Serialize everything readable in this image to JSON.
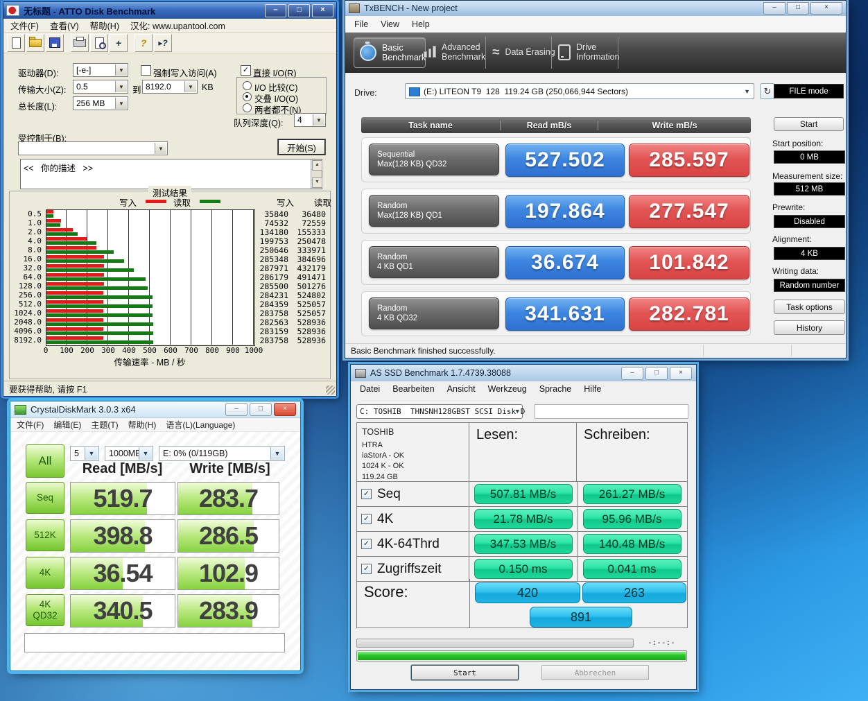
{
  "glyphs": {
    "minimize": "–",
    "maximize": "□",
    "close": "×",
    "dropdown": "▼",
    "up": "▲",
    "down": "▼",
    "check": "✓",
    "help": "?",
    "context_help": "?",
    "pan": "+",
    "refresh": "↻",
    "erase": "≈"
  },
  "atto": {
    "title": "无标题 - ATTO Disk Benchmark",
    "menu": {
      "file": "文件(F)",
      "view": "查看(V)",
      "help": "帮助(H)",
      "extra": "汉化: www.upantool.com"
    },
    "controls": {
      "drive_label": "驱动器(D):",
      "drive_value": "[-e-]",
      "force_write": "强制写入访问(A)",
      "direct_io": "直接 I/O(R)",
      "transfer_label": "传输大小(Z):",
      "transfer_from": "0.5",
      "to": "到",
      "transfer_to": "8192.0",
      "unit": "KB",
      "io_compare": "I/O 比较(C)",
      "overlapped": "交叠 I/O(O)",
      "neither": "两者都不(N)",
      "length_label": "总长度(L):",
      "length_value": "256 MB",
      "queue_label": "队列深度(Q):",
      "queue_value": "4",
      "controlled_by": "受控制于(B):",
      "start": "开始(S)",
      "description": "<<   你的描述   >>"
    },
    "results": {
      "group_title": "测试结果",
      "legend_write": "写入",
      "legend_read": "读取",
      "col_write": "写入",
      "col_read": "读取",
      "x_label": "传输速率 - MB / 秒"
    },
    "status": "要获得帮助, 请按 F1",
    "chart_data": {
      "type": "bar",
      "unit": "KB/s",
      "categories": [
        "0.5",
        "1.0",
        "2.0",
        "4.0",
        "8.0",
        "16.0",
        "32.0",
        "64.0",
        "128.0",
        "256.0",
        "512.0",
        "1024.0",
        "2048.0",
        "4096.0",
        "8192.0"
      ],
      "series": [
        {
          "name": "写入",
          "color": "#e31b1b",
          "values": [
            35840,
            74532,
            134180,
            199753,
            250646,
            285348,
            287971,
            286179,
            285500,
            284231,
            284359,
            283758,
            282563,
            283159,
            283758
          ]
        },
        {
          "name": "读取",
          "color": "#157a15",
          "values": [
            36480,
            72559,
            155333,
            250478,
            333971,
            384696,
            432179,
            491471,
            501276,
            524802,
            525057,
            525057,
            528936,
            528936,
            528936
          ]
        }
      ],
      "x_ticks": [
        0,
        100,
        200,
        300,
        400,
        500,
        600,
        700,
        800,
        900,
        1000
      ],
      "xlim": [
        0,
        1000
      ],
      "xlabel": "传输速率 - MB / 秒"
    }
  },
  "txbench": {
    "title": "TxBENCH - New project",
    "menu": [
      "File",
      "View",
      "Help"
    ],
    "tabs": [
      {
        "line1": "Basic",
        "line2": "Benchmark"
      },
      {
        "line1": "Advanced",
        "line2": "Benchmark"
      },
      {
        "line1": "Data Erasing",
        "line2": ""
      },
      {
        "line1": "Drive",
        "line2": "Information"
      }
    ],
    "drive_label": "Drive:",
    "drive_value": "(E:) LITEON T9  128  119.24 GB (250,066,944 Sectors)",
    "file_mode": "FILE mode",
    "table": {
      "headers": [
        "Task name",
        "Read mB/s",
        "Write mB/s"
      ],
      "rows": [
        {
          "name1": "Sequential",
          "name2": "Max(128 KB) QD32",
          "read": "527.502",
          "write": "285.597"
        },
        {
          "name1": "Random",
          "name2": "Max(128 KB) QD1",
          "read": "197.864",
          "write": "277.547"
        },
        {
          "name1": "Random",
          "name2": "4 KB QD1",
          "read": "36.674",
          "write": "101.842"
        },
        {
          "name1": "Random",
          "name2": "4 KB QD32",
          "read": "341.631",
          "write": "282.781"
        }
      ]
    },
    "panel": {
      "start": "Start",
      "start_pos_label": "Start position:",
      "start_pos": "0 MB",
      "meas_label": "Measurement size:",
      "meas": "512 MB",
      "prewrite_label": "Prewrite:",
      "prewrite": "Disabled",
      "align_label": "Alignment:",
      "align": "4 KB",
      "writing_label": "Writing data:",
      "writing": "Random number",
      "task_options": "Task options",
      "history": "History"
    },
    "status": "Basic Benchmark finished successfully."
  },
  "cdm": {
    "title": "CrystalDiskMark 3.0.3 x64",
    "menu": [
      "文件(F)",
      "编辑(E)",
      "主题(T)",
      "帮助(H)",
      "语言(L)(Language)"
    ],
    "all_button": "All",
    "runs": "5",
    "size": "1000MB",
    "drive": "E: 0% (0/119GB)",
    "read_header": "Read [MB/s]",
    "write_header": "Write [MB/s]",
    "rows": [
      {
        "label": "Seq",
        "read": "519.7",
        "write": "283.7",
        "read_fill": 73,
        "write_fill": 74
      },
      {
        "label": "512K",
        "read": "398.8",
        "write": "286.5",
        "read_fill": 71,
        "write_fill": 75
      },
      {
        "label": "4K",
        "read": "36.54",
        "write": "102.9",
        "read_fill": 50,
        "write_fill": 66
      },
      {
        "label": "4K QD32",
        "read": "340.5",
        "write": "283.9",
        "read_fill": 69,
        "write_fill": 74
      }
    ]
  },
  "asssd": {
    "title": "AS SSD Benchmark 1.7.4739.38088",
    "menu": [
      "Datei",
      "Bearbeiten",
      "Ansicht",
      "Werkzeug",
      "Sprache",
      "Hilfe"
    ],
    "drive_combo": "C: TOSHIB  THNSNH128GBST SCSI Disk D",
    "info": [
      "TOSHIB",
      "HTRA",
      "iaStorA - OK",
      "1024 K - OK",
      "119.24 GB"
    ],
    "read_header": "Lesen:",
    "write_header": "Schreiben:",
    "rows": [
      {
        "label": "Seq",
        "read": "507.81 MB/s",
        "write": "261.27 MB/s"
      },
      {
        "label": "4K",
        "read": "21.78 MB/s",
        "write": "95.96 MB/s"
      },
      {
        "label": "4K-64Thrd",
        "read": "347.53 MB/s",
        "write": "140.48 MB/s"
      },
      {
        "label": "Zugriffszeit",
        "read": "0.150 ms",
        "write": "0.041 ms"
      }
    ],
    "score_label": "Score:",
    "score_read": "420",
    "score_write": "263",
    "score_total": "891",
    "timer": "-:--:-",
    "start": "Start",
    "cancel": "Abbrechen"
  }
}
